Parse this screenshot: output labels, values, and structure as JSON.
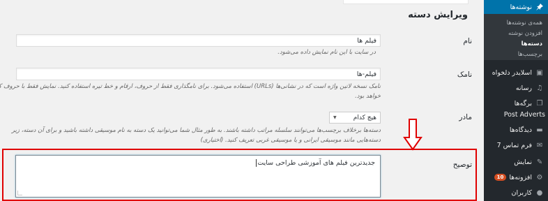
{
  "sidebar": {
    "active": {
      "label": "نوشته‌ها",
      "icon": "pin-icon"
    },
    "submenu": [
      {
        "label": "همه‌ی نوشته‌ها"
      },
      {
        "label": "افزودن نوشته"
      },
      {
        "label": "دسته‌ها"
      },
      {
        "label": "برچسب‌ها"
      }
    ],
    "items": [
      {
        "label": "اسلایدر دلخواه",
        "icon": "slider-icon"
      },
      {
        "label": "رسانه",
        "icon": "media-icon"
      },
      {
        "label": "برگه‌ها",
        "icon": "pages-icon"
      },
      {
        "label": "Post Adverts",
        "icon": ""
      },
      {
        "label": "دیدگاه‌ها",
        "icon": "comments-icon"
      },
      {
        "label": "فرم تماس 7",
        "icon": "mail-icon"
      },
      {
        "label": "نمایش",
        "icon": "appearance-icon"
      },
      {
        "label": "افزونه‌ها",
        "icon": "plugins-icon",
        "badge": "10"
      },
      {
        "label": "کاربران",
        "icon": "users-icon"
      }
    ]
  },
  "page_title": "ویرایش دسته",
  "form": {
    "name": {
      "label": "نام",
      "value": "فیلم ها",
      "help": "در سایت با این نام نمایش داده می‌شود."
    },
    "slug": {
      "label": "نامک",
      "value": "فیلم-ها",
      "help1": "نامک نسخه لاتین واژه است که در نشانی‌ها (URLs) استفاده می‌شود. برای نامگذاری فقط از حروف، ارقام و خط تیره استفاده کنید. نمایش فقط با حروف کوچک",
      "help2": "خواهد بود."
    },
    "parent": {
      "label": "مادر",
      "value": "هیچ کدام",
      "help1": "دسته‌ها برخلاف برچسب‌ها می‌توانند سلسله مراتب داشته باشند. به طور مثال شما می‌توانید یک دسته به نام موسیقی داشته باشید و برای آن دسته، زیر",
      "help2": "دسته‌هایی مانند موسیقی ایرانی و یا موسیقی غربی تعریف کنید. (اختیاری)"
    },
    "description": {
      "label": "توصیح",
      "value": "جدیدترین فیلم های آموزشی طراحی سایت"
    }
  },
  "colors": {
    "accent": "#0073aa",
    "sidebar": "#23282d",
    "highlight": "#e00000"
  }
}
